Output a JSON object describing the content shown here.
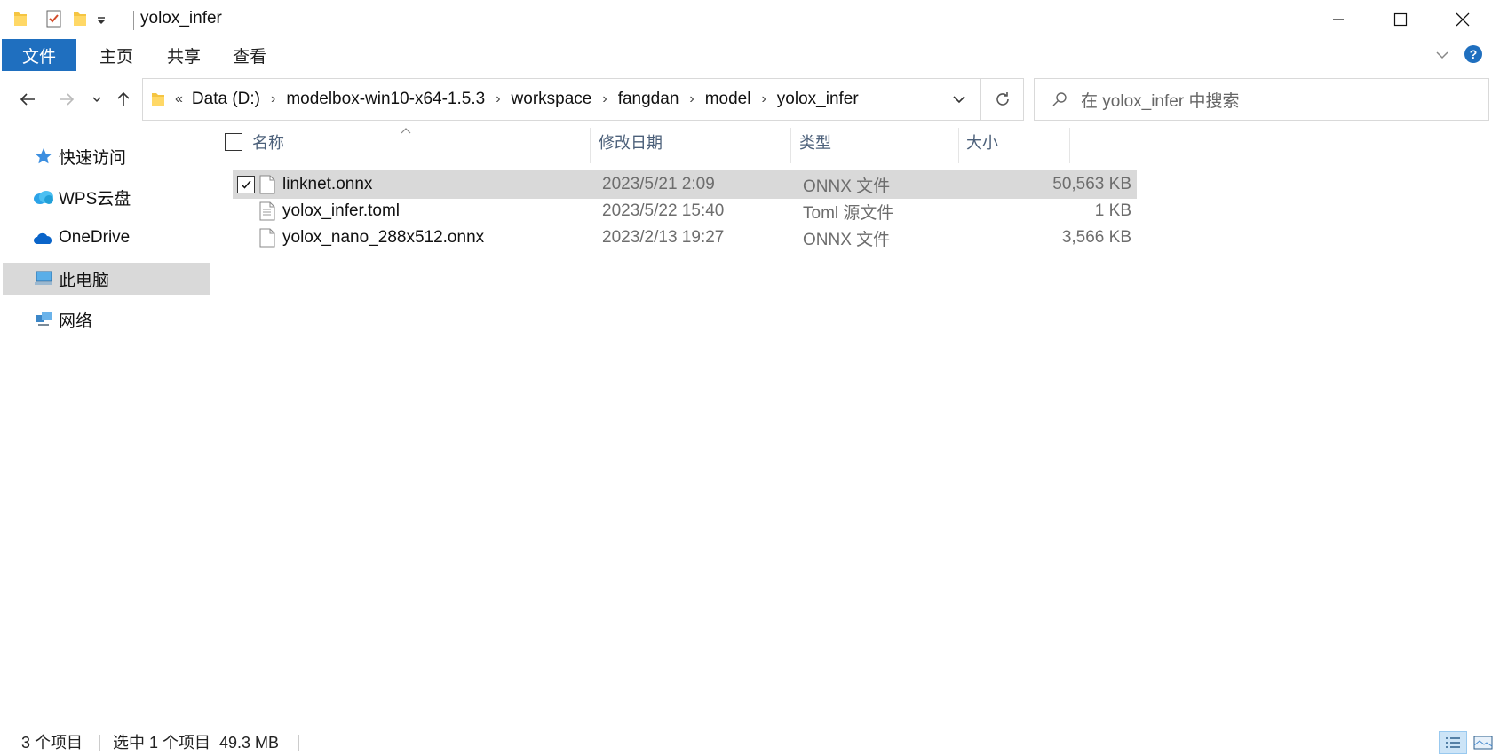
{
  "window": {
    "title": "yolox_infer"
  },
  "ribbon": {
    "tabs": [
      "文件",
      "主页",
      "共享",
      "查看"
    ]
  },
  "address": {
    "overflow": "«",
    "crumbs": [
      "Data (D:)",
      "modelbox-win10-x64-1.5.3",
      "workspace",
      "fangdan",
      "model",
      "yolox_infer"
    ]
  },
  "search": {
    "placeholder": "在 yolox_infer 中搜索"
  },
  "sidebar": {
    "items": [
      {
        "label": "快速访问",
        "icon": "quick-access-star-icon"
      },
      {
        "label": "WPS云盘",
        "icon": "wps-cloud-icon"
      },
      {
        "label": "OneDrive",
        "icon": "onedrive-cloud-icon"
      },
      {
        "label": "此电脑",
        "icon": "this-pc-icon",
        "selected": true
      },
      {
        "label": "网络",
        "icon": "network-icon"
      }
    ]
  },
  "columns": {
    "name": "名称",
    "date": "修改日期",
    "type": "类型",
    "size": "大小"
  },
  "files": [
    {
      "name": "linknet.onnx",
      "date": "2023/5/21 2:09",
      "type": "ONNX 文件",
      "size": "50,563 KB",
      "selected": true
    },
    {
      "name": "yolox_infer.toml",
      "date": "2023/5/22 15:40",
      "type": "Toml 源文件",
      "size": "1 KB",
      "selected": false
    },
    {
      "name": "yolox_nano_288x512.onnx",
      "date": "2023/2/13 19:27",
      "type": "ONNX 文件",
      "size": "3,566 KB",
      "selected": false
    }
  ],
  "status": {
    "count": "3 个项目",
    "selection": "选中 1 个项目  49.3 MB"
  },
  "colors": {
    "accent": "#1f6fbf",
    "selection": "#d9d9d9",
    "header_text": "#4c607a"
  }
}
